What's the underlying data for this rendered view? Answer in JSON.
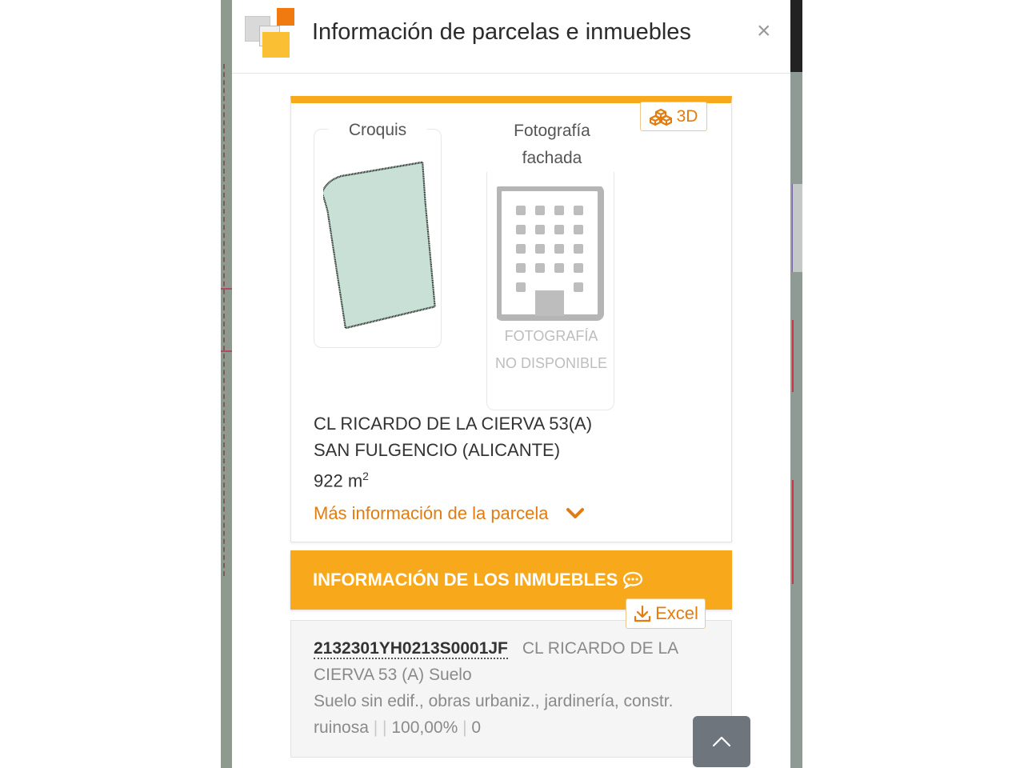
{
  "header": {
    "title": "Información de parcelas e inmuebles",
    "close_label": "×"
  },
  "parcel": {
    "btn_3d_label": "3D",
    "croquis_label": "Croquis",
    "foto_label_line1": "Fotografía",
    "foto_label_line2": "fachada",
    "foto_na_line1": "FOTOGRAFÍA",
    "foto_na_line2": "NO DISPONIBLE",
    "address_line1": "CL RICARDO DE LA CIERVA 53(A)",
    "address_line2": "SAN FULGENCIO (ALICANTE)",
    "area_value": "922 m",
    "area_exp": "2",
    "more_info_label": "Más información de la parcela"
  },
  "inmuebles": {
    "section_title": "INFORMACIÓN DE LOS INMUEBLES",
    "excel_label": "Excel",
    "items": [
      {
        "ref": "2132301YH0213S0001JF",
        "address": "CL RICARDO DE LA CIERVA 53 (A) Suelo",
        "usage": "Suelo sin edif., obras urbaniz., jardinería, constr. ruinosa",
        "sep1": "|",
        "sep2": "|",
        "percent": "100,00%",
        "sep3": "|",
        "value": "0"
      }
    ]
  },
  "colors": {
    "accent": "#f8a81b",
    "accent_text": "#e27c10",
    "parcel_fill": "#c8e0d6"
  },
  "icons": {
    "close": "close-icon",
    "cubes": "cubes-icon",
    "chevron": "chevron-down-icon",
    "comment": "comment-icon",
    "download": "download-icon",
    "scroll_top": "chevron-up-icon"
  }
}
